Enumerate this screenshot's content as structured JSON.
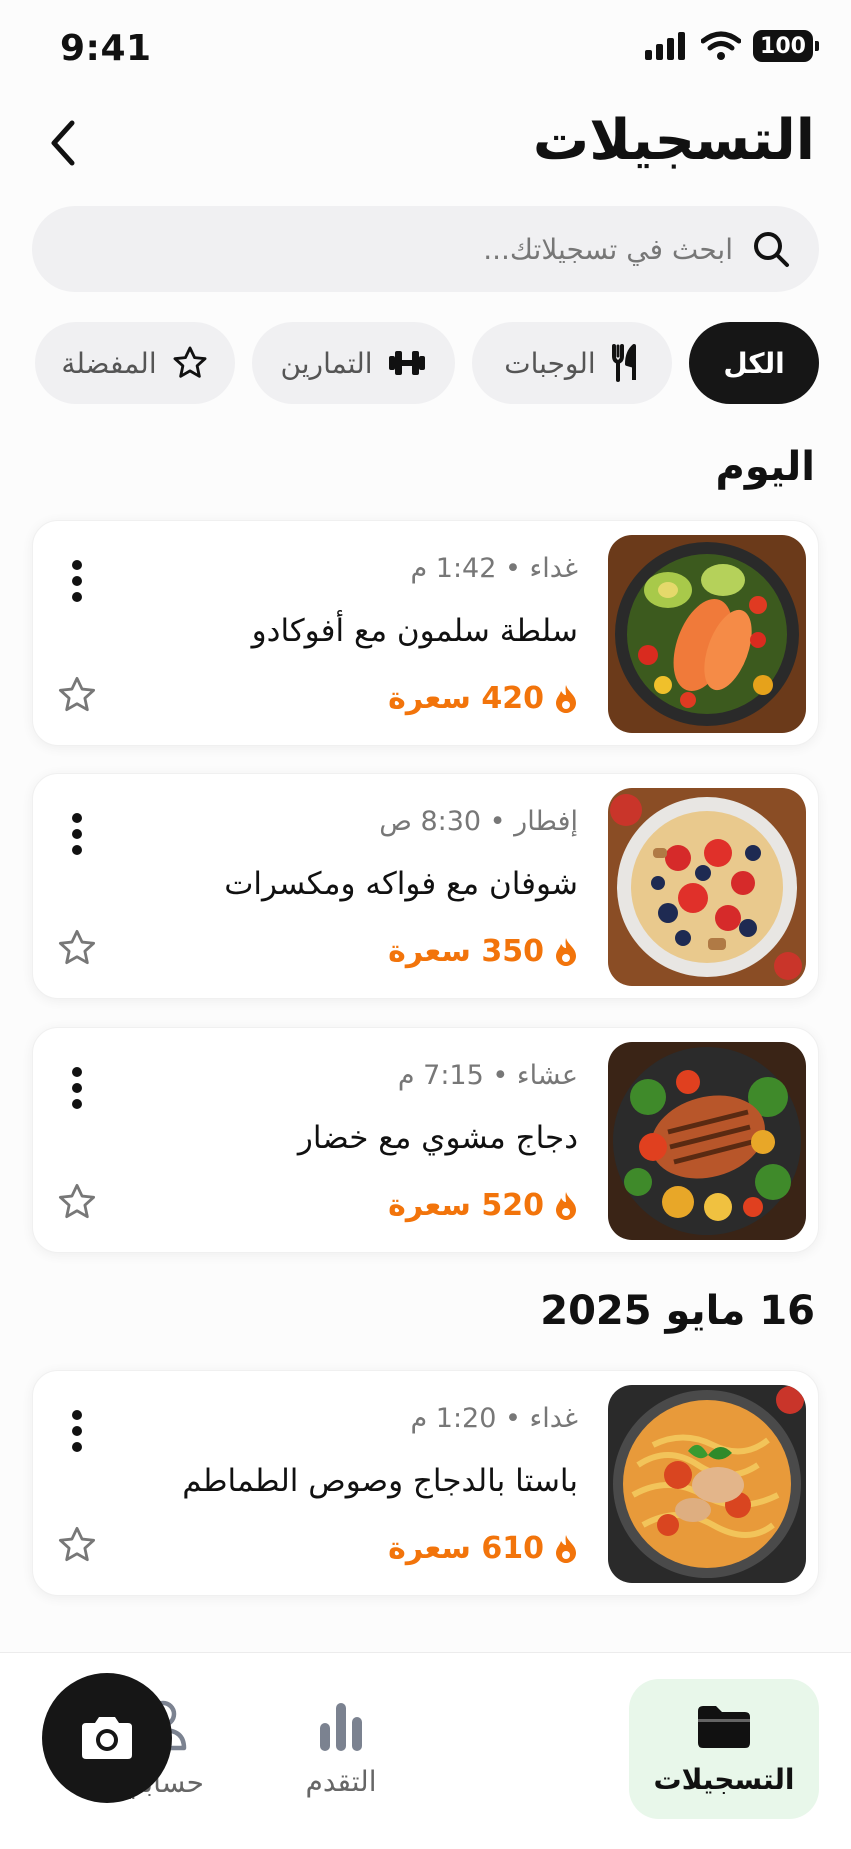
{
  "status_bar": {
    "time": "9:41",
    "battery": "100"
  },
  "header": {
    "title": "التسجيلات"
  },
  "search": {
    "placeholder": "ابحث في تسجيلاتك..."
  },
  "filters": [
    {
      "label": "الكل",
      "icon": "none",
      "active": true
    },
    {
      "label": "الوجبات",
      "icon": "fork-knife-icon",
      "active": false
    },
    {
      "label": "التمارين",
      "icon": "dumbbell-icon",
      "active": false
    },
    {
      "label": "المفضلة",
      "icon": "star-icon",
      "active": false
    }
  ],
  "sections": [
    {
      "title": "اليوم",
      "entries": [
        {
          "meta": "غداء • 1:42 م",
          "title": "سلطة سلمون مع أفوكادو",
          "calories": "420 سعرة",
          "image": "salmon-salad"
        },
        {
          "meta": "إفطار • 8:30 ص",
          "title": "شوفان مع فواكه ومكسرات",
          "calories": "350 سعرة",
          "image": "oatmeal-fruit"
        },
        {
          "meta": "عشاء • 7:15 م",
          "title": "دجاج مشوي مع خضار",
          "calories": "520 سعرة",
          "image": "grilled-chicken"
        }
      ]
    },
    {
      "title": "16 مايو 2025",
      "entries": [
        {
          "meta": "غداء • 1:20 م",
          "title": "باستا بالدجاج وصوص الطماطم",
          "calories": "610 سعرة",
          "image": "chicken-pasta"
        }
      ]
    }
  ],
  "bottom_nav": {
    "records": "التسجيلات",
    "progress": "التقدم",
    "account": "حسابي"
  },
  "colors": {
    "accent": "#f2740b",
    "active_nav_bg": "#e8f7ea",
    "dark": "#161616"
  }
}
